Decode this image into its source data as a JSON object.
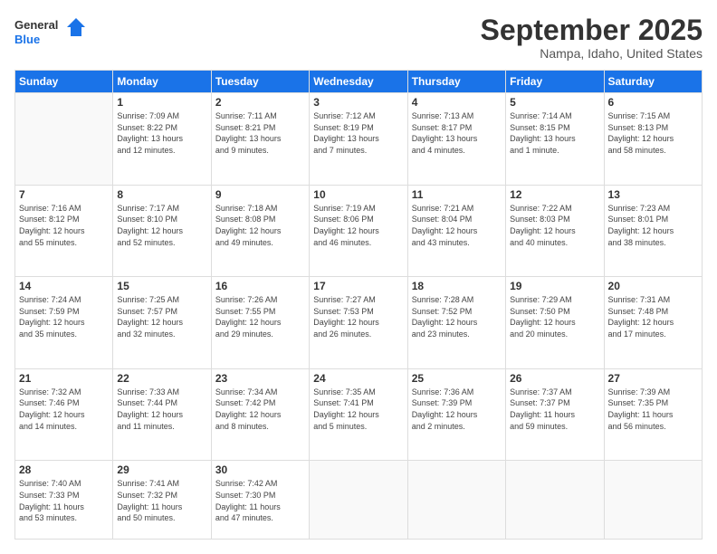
{
  "logo": {
    "line1": "General",
    "line2": "Blue"
  },
  "header": {
    "month": "September 2025",
    "location": "Nampa, Idaho, United States"
  },
  "weekdays": [
    "Sunday",
    "Monday",
    "Tuesday",
    "Wednesday",
    "Thursday",
    "Friday",
    "Saturday"
  ],
  "weeks": [
    [
      {
        "day": "",
        "info": ""
      },
      {
        "day": "1",
        "info": "Sunrise: 7:09 AM\nSunset: 8:22 PM\nDaylight: 13 hours\nand 12 minutes."
      },
      {
        "day": "2",
        "info": "Sunrise: 7:11 AM\nSunset: 8:21 PM\nDaylight: 13 hours\nand 9 minutes."
      },
      {
        "day": "3",
        "info": "Sunrise: 7:12 AM\nSunset: 8:19 PM\nDaylight: 13 hours\nand 7 minutes."
      },
      {
        "day": "4",
        "info": "Sunrise: 7:13 AM\nSunset: 8:17 PM\nDaylight: 13 hours\nand 4 minutes."
      },
      {
        "day": "5",
        "info": "Sunrise: 7:14 AM\nSunset: 8:15 PM\nDaylight: 13 hours\nand 1 minute."
      },
      {
        "day": "6",
        "info": "Sunrise: 7:15 AM\nSunset: 8:13 PM\nDaylight: 12 hours\nand 58 minutes."
      }
    ],
    [
      {
        "day": "7",
        "info": "Sunrise: 7:16 AM\nSunset: 8:12 PM\nDaylight: 12 hours\nand 55 minutes."
      },
      {
        "day": "8",
        "info": "Sunrise: 7:17 AM\nSunset: 8:10 PM\nDaylight: 12 hours\nand 52 minutes."
      },
      {
        "day": "9",
        "info": "Sunrise: 7:18 AM\nSunset: 8:08 PM\nDaylight: 12 hours\nand 49 minutes."
      },
      {
        "day": "10",
        "info": "Sunrise: 7:19 AM\nSunset: 8:06 PM\nDaylight: 12 hours\nand 46 minutes."
      },
      {
        "day": "11",
        "info": "Sunrise: 7:21 AM\nSunset: 8:04 PM\nDaylight: 12 hours\nand 43 minutes."
      },
      {
        "day": "12",
        "info": "Sunrise: 7:22 AM\nSunset: 8:03 PM\nDaylight: 12 hours\nand 40 minutes."
      },
      {
        "day": "13",
        "info": "Sunrise: 7:23 AM\nSunset: 8:01 PM\nDaylight: 12 hours\nand 38 minutes."
      }
    ],
    [
      {
        "day": "14",
        "info": "Sunrise: 7:24 AM\nSunset: 7:59 PM\nDaylight: 12 hours\nand 35 minutes."
      },
      {
        "day": "15",
        "info": "Sunrise: 7:25 AM\nSunset: 7:57 PM\nDaylight: 12 hours\nand 32 minutes."
      },
      {
        "day": "16",
        "info": "Sunrise: 7:26 AM\nSunset: 7:55 PM\nDaylight: 12 hours\nand 29 minutes."
      },
      {
        "day": "17",
        "info": "Sunrise: 7:27 AM\nSunset: 7:53 PM\nDaylight: 12 hours\nand 26 minutes."
      },
      {
        "day": "18",
        "info": "Sunrise: 7:28 AM\nSunset: 7:52 PM\nDaylight: 12 hours\nand 23 minutes."
      },
      {
        "day": "19",
        "info": "Sunrise: 7:29 AM\nSunset: 7:50 PM\nDaylight: 12 hours\nand 20 minutes."
      },
      {
        "day": "20",
        "info": "Sunrise: 7:31 AM\nSunset: 7:48 PM\nDaylight: 12 hours\nand 17 minutes."
      }
    ],
    [
      {
        "day": "21",
        "info": "Sunrise: 7:32 AM\nSunset: 7:46 PM\nDaylight: 12 hours\nand 14 minutes."
      },
      {
        "day": "22",
        "info": "Sunrise: 7:33 AM\nSunset: 7:44 PM\nDaylight: 12 hours\nand 11 minutes."
      },
      {
        "day": "23",
        "info": "Sunrise: 7:34 AM\nSunset: 7:42 PM\nDaylight: 12 hours\nand 8 minutes."
      },
      {
        "day": "24",
        "info": "Sunrise: 7:35 AM\nSunset: 7:41 PM\nDaylight: 12 hours\nand 5 minutes."
      },
      {
        "day": "25",
        "info": "Sunrise: 7:36 AM\nSunset: 7:39 PM\nDaylight: 12 hours\nand 2 minutes."
      },
      {
        "day": "26",
        "info": "Sunrise: 7:37 AM\nSunset: 7:37 PM\nDaylight: 11 hours\nand 59 minutes."
      },
      {
        "day": "27",
        "info": "Sunrise: 7:39 AM\nSunset: 7:35 PM\nDaylight: 11 hours\nand 56 minutes."
      }
    ],
    [
      {
        "day": "28",
        "info": "Sunrise: 7:40 AM\nSunset: 7:33 PM\nDaylight: 11 hours\nand 53 minutes."
      },
      {
        "day": "29",
        "info": "Sunrise: 7:41 AM\nSunset: 7:32 PM\nDaylight: 11 hours\nand 50 minutes."
      },
      {
        "day": "30",
        "info": "Sunrise: 7:42 AM\nSunset: 7:30 PM\nDaylight: 11 hours\nand 47 minutes."
      },
      {
        "day": "",
        "info": ""
      },
      {
        "day": "",
        "info": ""
      },
      {
        "day": "",
        "info": ""
      },
      {
        "day": "",
        "info": ""
      }
    ]
  ]
}
